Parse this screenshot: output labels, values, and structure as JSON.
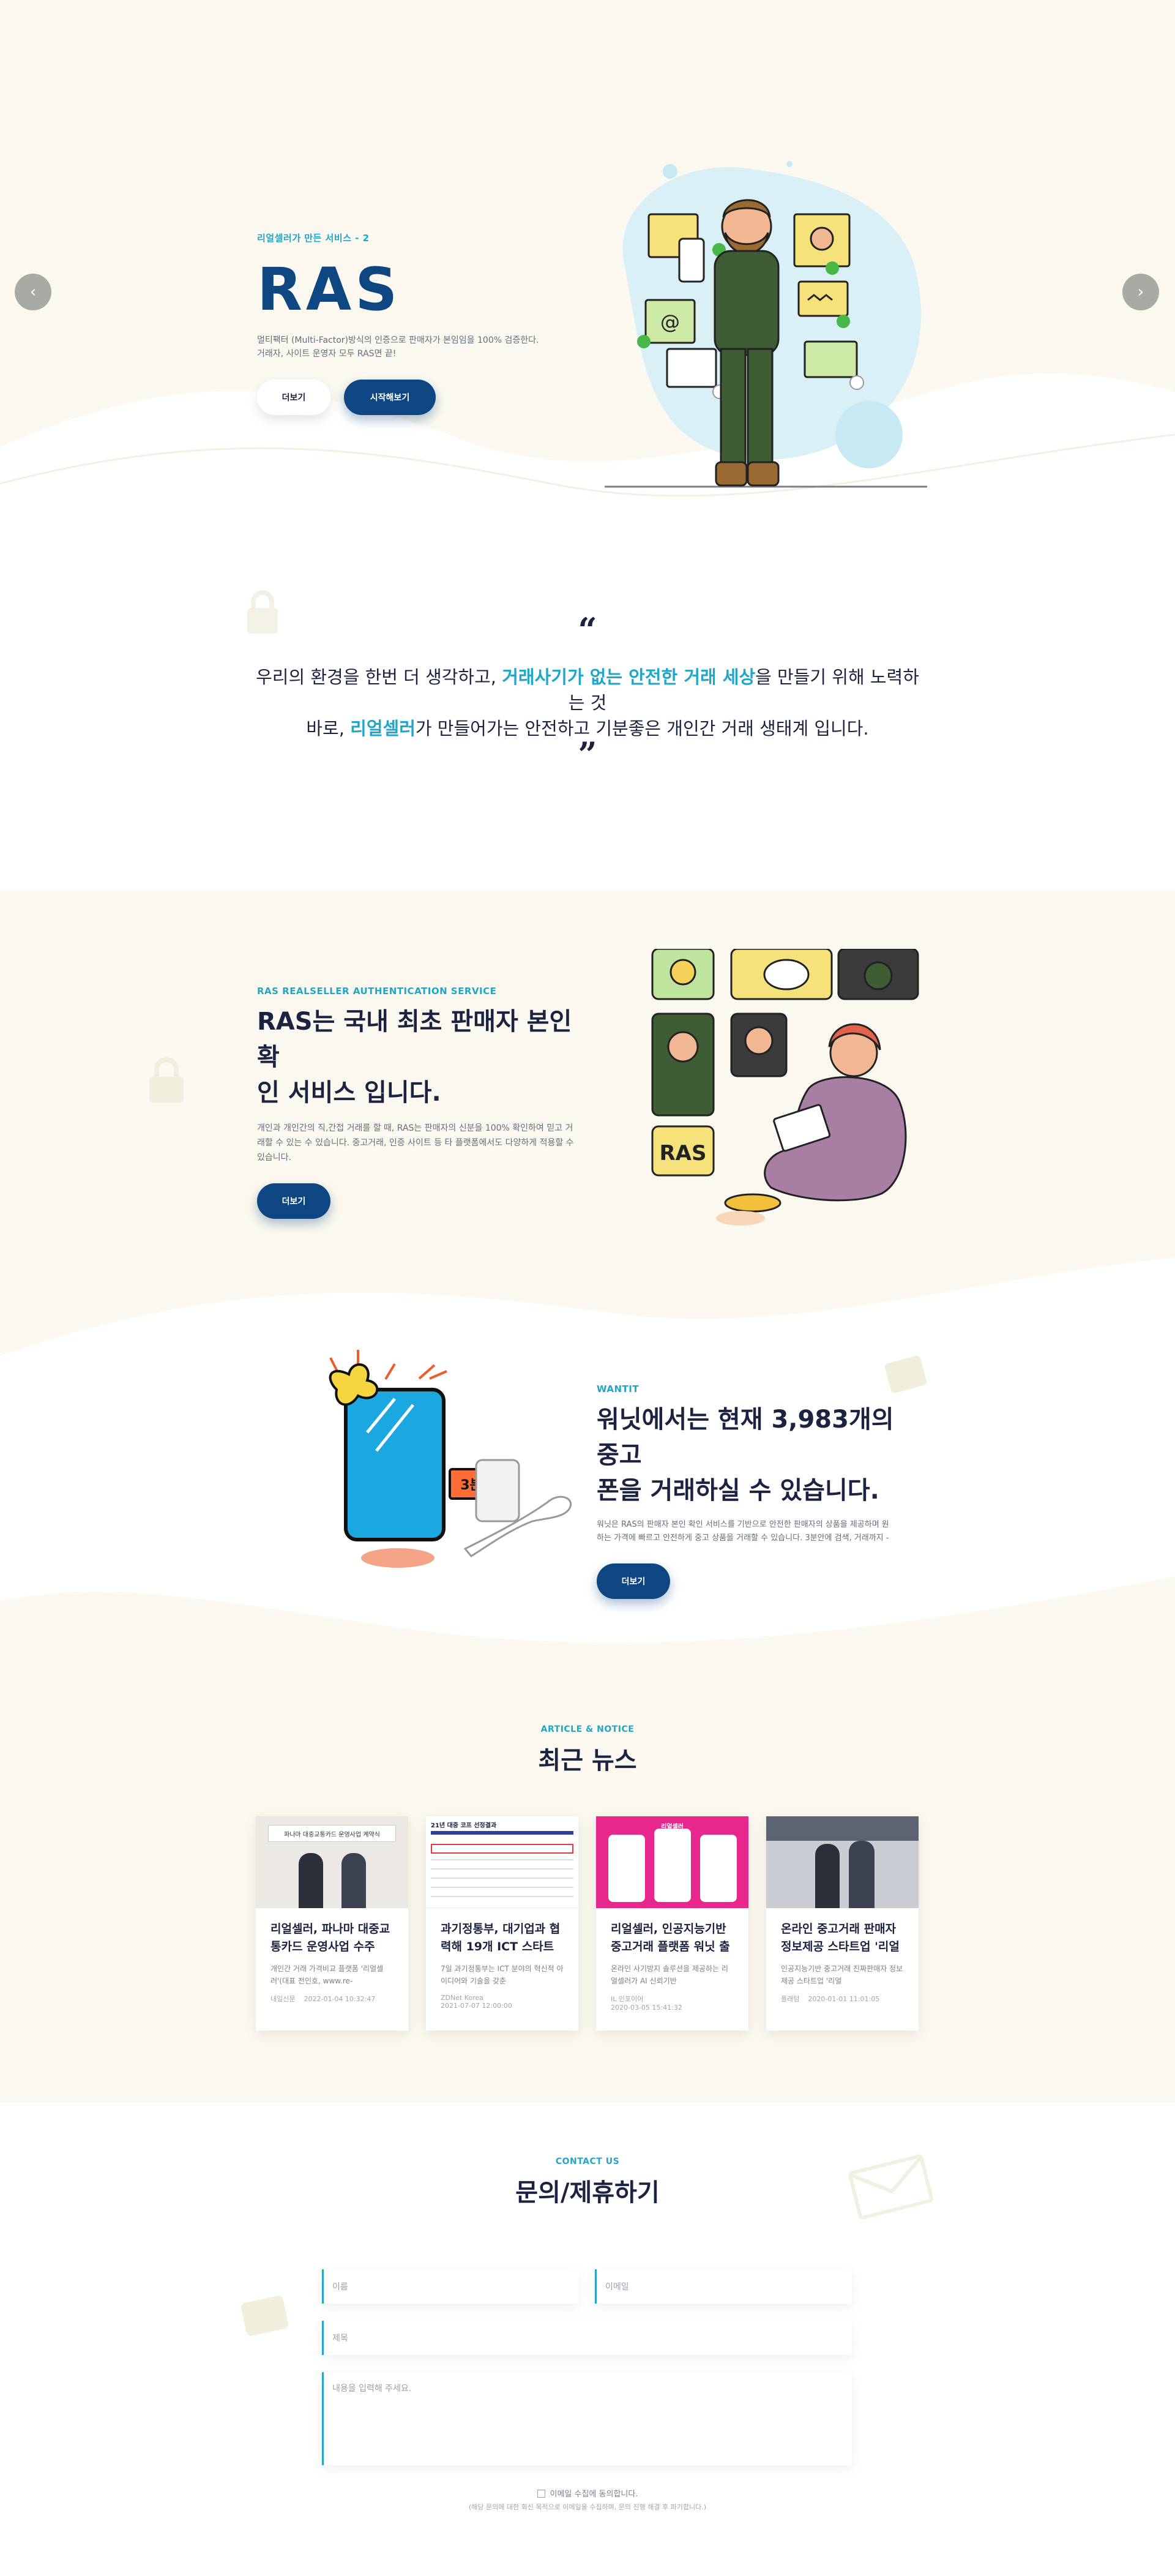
{
  "hero": {
    "eyebrow": "리얼셀러가 만든 서비스 - 2",
    "logo_text": "RAS",
    "desc_line1": "멀티팩터 (Multi-Factor)방식의 인증으로 판매자가 본임임을 100% 검증한다.",
    "desc_line2": "거래자, 사이트 운영자 모두 RAS면 끝!",
    "more_label": "더보기",
    "start_label": "시작해보기",
    "prev_icon": "chevron-left-icon",
    "next_icon": "chevron-right-icon"
  },
  "quote": {
    "line1_a": "우리의 환경을 한번 더 생각하고, ",
    "line1_hl": "거래사기가 없는 안전한 거래 세상",
    "line1_b": "을 만들기 위해 노력하는 것",
    "line2_a": "바로, ",
    "line2_hl": "리얼셀러",
    "line2_b": "가 만들어가는 안전하고 기분좋은 개인간 거래 생태계 입니다."
  },
  "intro": {
    "eyebrow": "RAS REALSELLER AUTHENTICATION SERVICE",
    "title_line1": "RAS는 국내 최초 판매자 본인 확",
    "title_line2": "인 서비스 입니다.",
    "desc_line1": "개인과 개인간의 직,간접 거래를 할 때, RAS는 판매자의 신분을 100% 확인하여 믿고 거",
    "desc_line2": "래할 수 있는 수 있습니다. 중고거래, 인증 사이트 등 타 플랫폼에서도 다양하게 적용할 수",
    "desc_line3": "있습니다.",
    "more_label": "더보기",
    "badge_text": "RAS"
  },
  "wantit": {
    "eyebrow": "WANTIT",
    "title_line1": "워닛에서는 현재 3,983개의 중고",
    "title_line2": "폰을 거래하실 수 있습니다.",
    "desc_line1": "워닛은 RAS의 판매자 본인 확인 서비스를 기반으로 안전한 판매자의 상품을 제공하며 원",
    "desc_line2": "하는 가격에 빠르고 안전하게 중고 상품을 거래할 수 있습니다. 3분안에 검색, 거래까지 -",
    "more_label": "더보기",
    "bubble_text": "3분!"
  },
  "news": {
    "eyebrow": "ARTICLE & NOTICE",
    "title": "최근 뉴스",
    "cards": [
      {
        "title": "리얼셀러, 파나마 대중교통카드 운영사업 수주",
        "desc": "개인간 거래 가격비교 플랫폼 '리얼셀러'(대표 전인호, www.re-",
        "source": "내일신문",
        "date": "2022-01-04 10:32:47",
        "thumb_caption": "파나마 대중교통카드 운영사업 계약식"
      },
      {
        "title": "과기정통부, 대기업과 협력해 19개 ICT 스타트업",
        "desc": "7일 과기정통부는 ICT 분야의 혁신적 아이디어와 기술을 갖춘",
        "source": "ZDNet Korea",
        "date": "2021-07-07 12:00:00",
        "thumb_caption": "21년 대중 코프 선정결과"
      },
      {
        "title": "리얼셀러, 인공지능기반 중고거래 플랫폼 워닛 출시",
        "desc": "온라인 사기방지 솔루션을 제공하는 리얼셀러가 AI 신뢰기반",
        "source": "IL 인포이어",
        "date": "2020-03-05 15:41:32",
        "thumb_caption": "리얼셀러"
      },
      {
        "title": "온라인 중고거래 판매자 정보제공 스타트업 '리얼셀러'",
        "desc": "인공지능기반 중고거래 진짜판매자 정보제공 스타트업 '리얼",
        "source": "플래텀",
        "date": "2020-01-01 11:01:05",
        "thumb_caption": ""
      }
    ]
  },
  "contact": {
    "eyebrow": "CONTACT US",
    "title": "문의/제휴하기",
    "name_placeholder": "이름",
    "email_placeholder": "이메일",
    "subject_placeholder": "제목",
    "message_placeholder": "내용을 입력해 주세요.",
    "agree_label": "이메일 수집에 동의합니다.",
    "agree_note": "(해당 문의에 대한 회신 목적으로 이메일을 수집하며, 문의 진행 해결 후 파기합니다.)"
  },
  "colors": {
    "navy": "#0d4680",
    "accent": "#1fa6c8",
    "cream": "#fbf9ef",
    "text": "#1c2340"
  }
}
